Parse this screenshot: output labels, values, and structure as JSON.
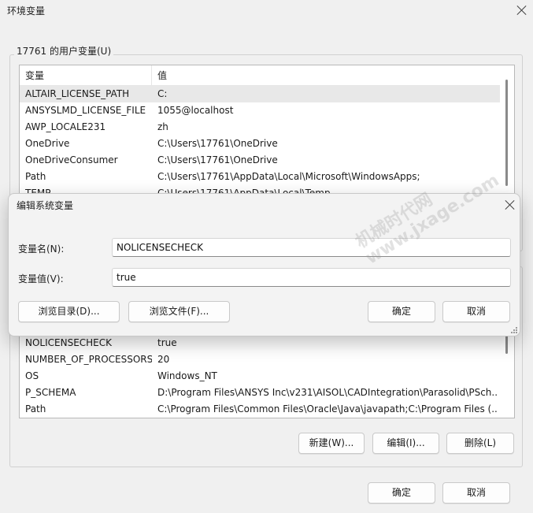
{
  "window": {
    "title": "环境变量"
  },
  "user_vars": {
    "group_label": "17761 的用户变量(U)",
    "columns": [
      "变量",
      "值"
    ],
    "rows": [
      {
        "name": "ALTAIR_LICENSE_PATH",
        "value": "C:"
      },
      {
        "name": "ANSYSLMD_LICENSE_FILE",
        "value": "1055@localhost"
      },
      {
        "name": "AWP_LOCALE231",
        "value": "zh"
      },
      {
        "name": "OneDrive",
        "value": "C:\\Users\\17761\\OneDrive"
      },
      {
        "name": "OneDriveConsumer",
        "value": "C:\\Users\\17761\\OneDrive"
      },
      {
        "name": "Path",
        "value": "C:\\Users\\17761\\AppData\\Local\\Microsoft\\WindowsApps;"
      },
      {
        "name": "TEMP",
        "value": "C:\\Users\\17761\\AppData\\Local\\Temp"
      }
    ]
  },
  "system_vars": {
    "rows": [
      {
        "name": "NOLICENSECHECK",
        "value": "true"
      },
      {
        "name": "NUMBER_OF_PROCESSORS",
        "value": "20"
      },
      {
        "name": "OS",
        "value": "Windows_NT"
      },
      {
        "name": "P_SCHEMA",
        "value": "D:\\Program Files\\ANSYS Inc\\v231\\AISOL\\CADIntegration\\Parasolid\\PSch..."
      },
      {
        "name": "Path",
        "value": "C:\\Program Files\\Common Files\\Oracle\\Java\\javapath;C:\\Program Files (..."
      }
    ],
    "buttons": {
      "new": "新建(W)...",
      "edit": "编辑(I)...",
      "delete": "删除(L)"
    }
  },
  "footer": {
    "ok": "确定",
    "cancel": "取消"
  },
  "edit_dialog": {
    "title": "编辑系统变量",
    "name_label": "变量名(N):",
    "name_value": "NOLICENSECHECK",
    "value_label": "变量值(V):",
    "value_value": "true",
    "browse_dir": "浏览目录(D)...",
    "browse_file": "浏览文件(F)...",
    "ok": "确定",
    "cancel": "取消"
  },
  "watermark": {
    "line1": "机械时代网",
    "line2": "www.jxage.com"
  }
}
